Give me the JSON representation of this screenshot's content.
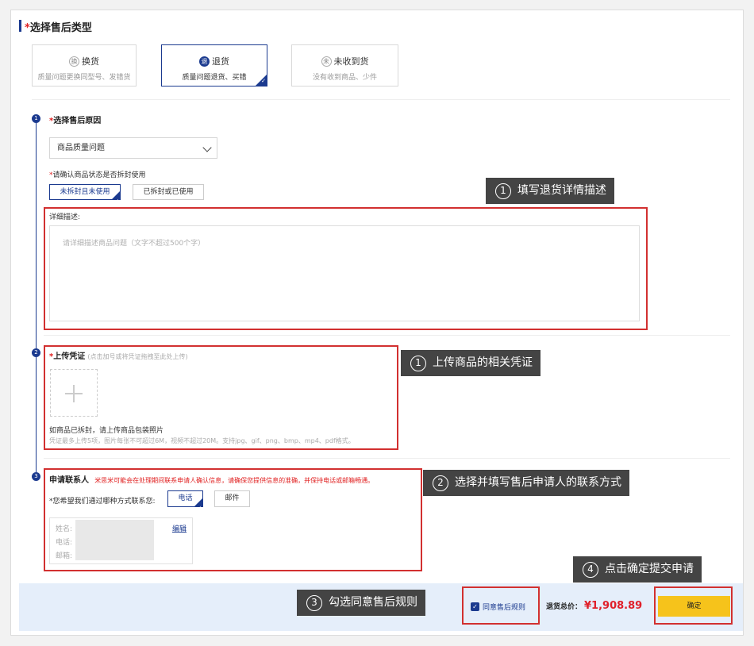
{
  "section_title": "选择售后类型",
  "required_mark": "*",
  "service_types": [
    {
      "icon_char": "换",
      "label": "换货",
      "desc": "质量问题更换同型号、发错货",
      "selected": false
    },
    {
      "icon_char": "退",
      "label": "退货",
      "desc": "质量问题退货、买错",
      "selected": true
    },
    {
      "icon_char": "未",
      "label": "未收到货",
      "desc": "没有收到商品、少件",
      "selected": false
    }
  ],
  "steps": [
    "1",
    "2",
    "3"
  ],
  "reason": {
    "title": "选择售后原因",
    "selected": "商品质量问题",
    "status_question": "请确认商品状态是否拆封使用",
    "status_options": [
      "未拆封且未使用",
      "已拆封或已使用"
    ],
    "detail_label": "详细描述:",
    "detail_placeholder": "请详细描述商品问题（文字不超过500个字）"
  },
  "upload": {
    "title": "上传凭证",
    "hint": "(点击加号或将凭证拖拽至此处上传)",
    "note": "如商品已拆封，请上传商品包装照片",
    "limits": "凭证最多上传5项，图片每张不可超过6M，视频不超过20M。支持jpg、gif、png、bmp、mp4、pdf格式。"
  },
  "contact": {
    "title": "申请联系人",
    "notice": "米思米可能会在处理期间联系申请人确认信息，请确保您提供信息的准确，并保持电话或邮箱畅通。",
    "method_question": "*您希望我们通过哪种方式联系您:",
    "methods": [
      "电话",
      "邮件"
    ],
    "fields": [
      "姓名:",
      "电话:",
      "邮箱:"
    ],
    "edit_label": "编辑"
  },
  "callouts": [
    {
      "num": "1",
      "text": "填写退货详情描述"
    },
    {
      "num": "1",
      "text": "上传商品的相关凭证"
    },
    {
      "num": "2",
      "text": "选择并填写售后申请人的联系方式"
    },
    {
      "num": "3",
      "text": "勾选同意售后规则"
    },
    {
      "num": "4",
      "text": "点击确定提交申请"
    }
  ],
  "footer": {
    "agree_label": "同意售后规则",
    "agreed": true,
    "total_label": "退货总价：",
    "total_value": "¥1,908.89",
    "confirm_label": "确定"
  },
  "colors": {
    "accent": "#1b3a8f",
    "highlight": "#d23030",
    "price": "#e0202a",
    "confirm_bg": "#f6c31b"
  }
}
